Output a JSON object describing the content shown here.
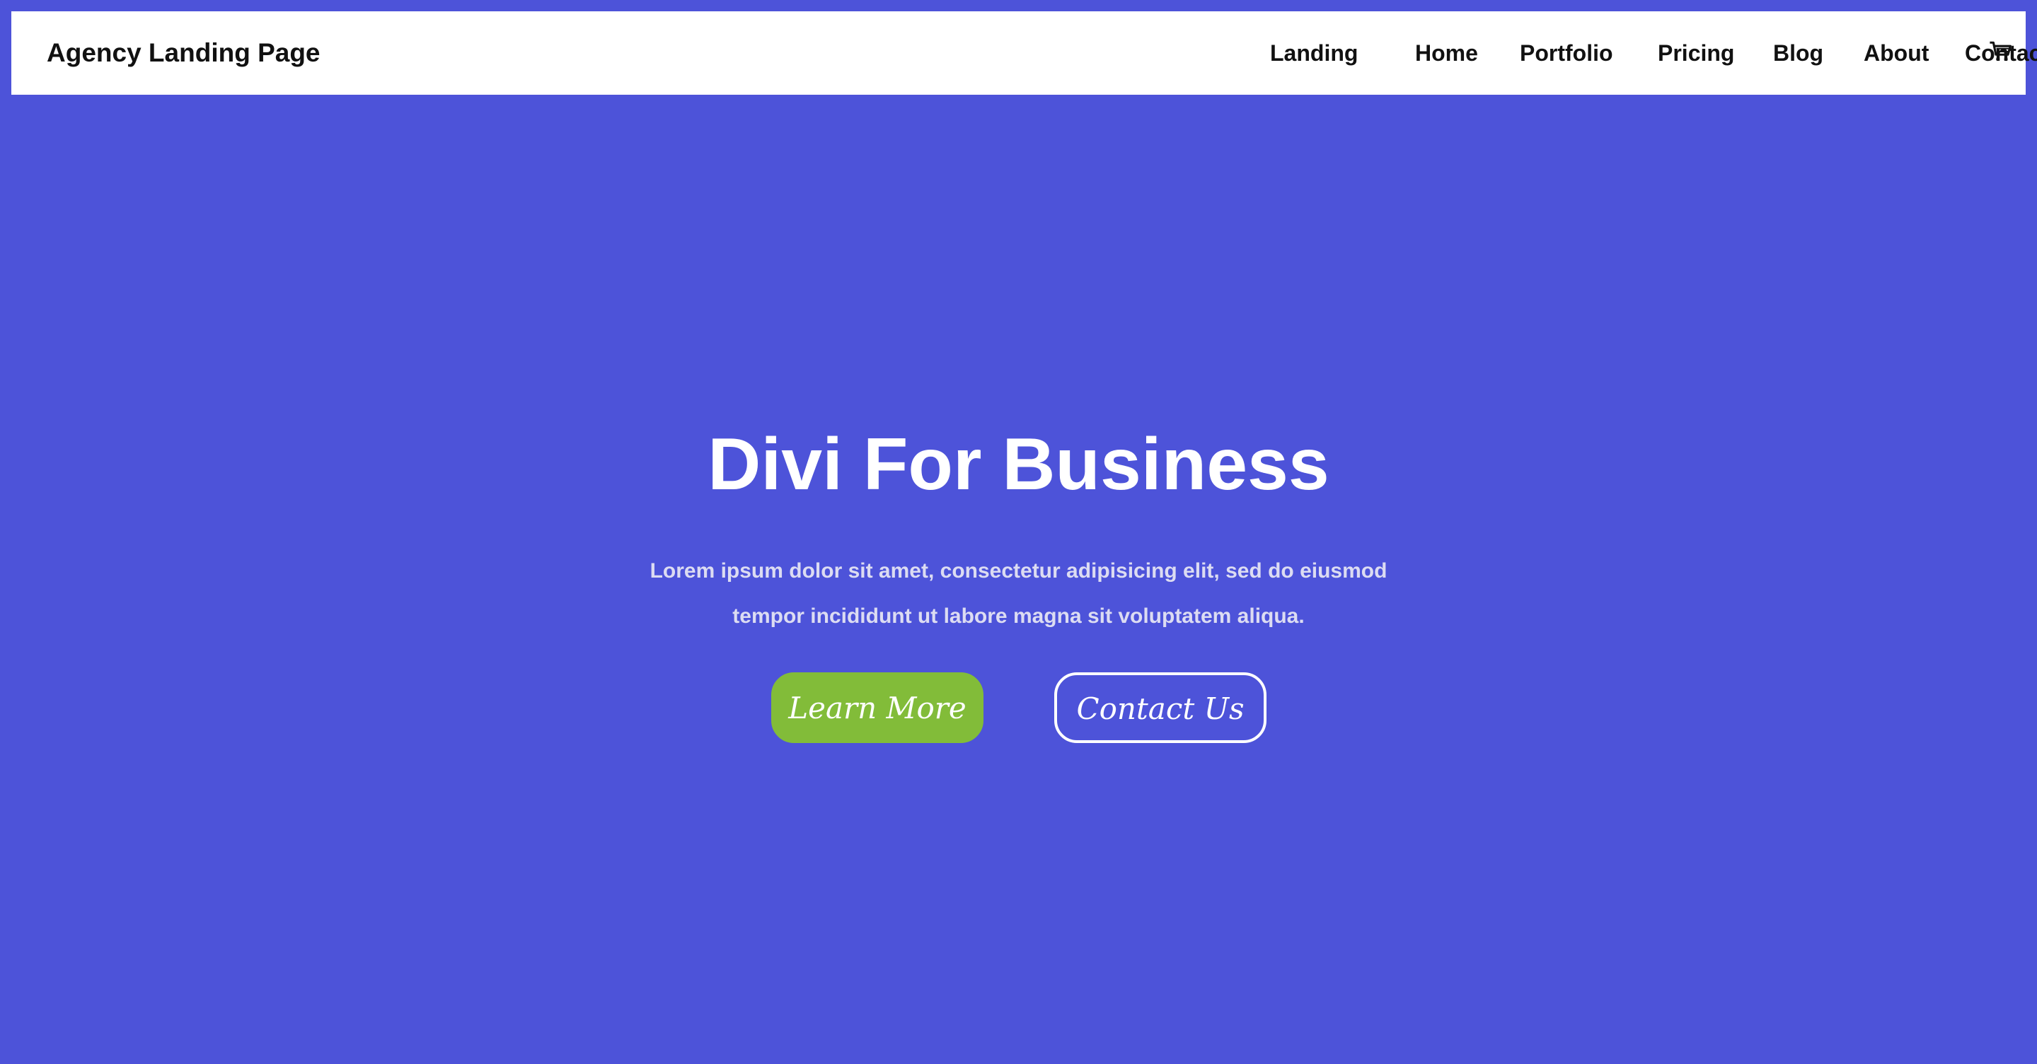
{
  "header": {
    "site_title": "Agency Landing Page",
    "nav": [
      {
        "label": "Landing"
      },
      {
        "label": "Home"
      },
      {
        "label": "Portfolio"
      },
      {
        "label": "Pricing"
      },
      {
        "label": "Blog"
      },
      {
        "label": "About"
      },
      {
        "label": "Contact"
      }
    ],
    "cart_icon": "shopping-cart-icon"
  },
  "hero": {
    "title": "Divi For Business",
    "text_line1": "Lorem ipsum dolor sit amet, consectetur adipisicing elit, sed do eiusmod",
    "text_line2": "tempor incididunt ut labore magna sit voluptatem aliqua.",
    "primary_button": "Learn More",
    "secondary_button": "Contact Us"
  },
  "colors": {
    "background": "#4d53d9",
    "header_background": "#ffffff",
    "primary_button": "#82bc39",
    "text_light": "#ffffff"
  }
}
